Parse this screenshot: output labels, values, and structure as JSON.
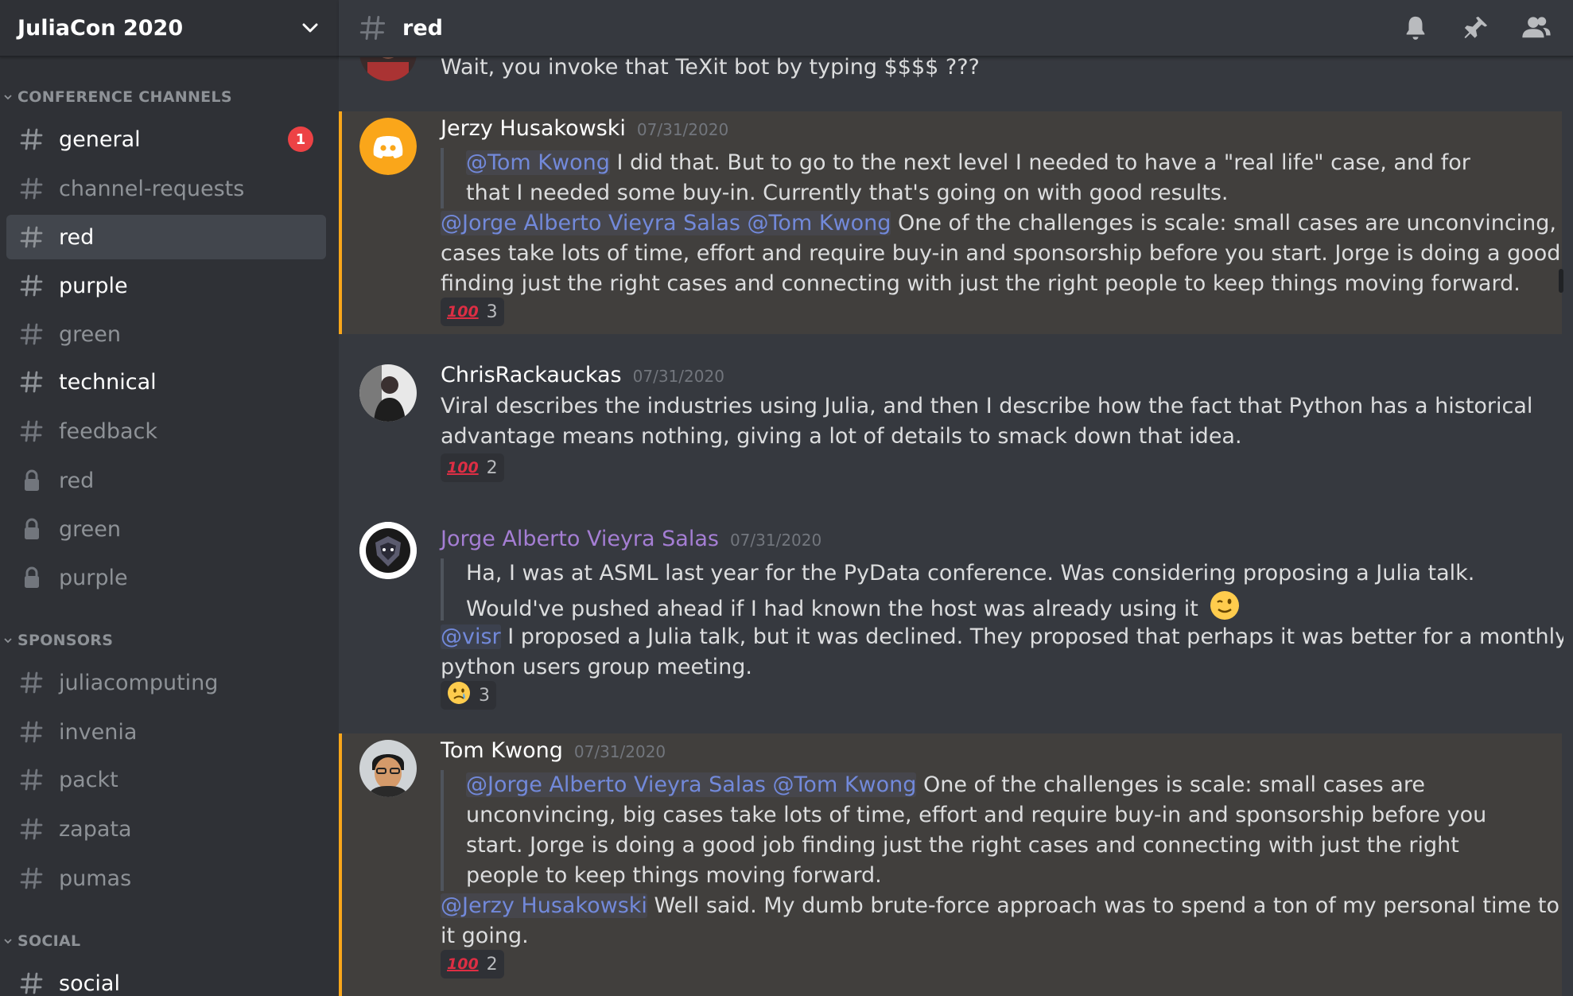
{
  "guild": {
    "name": "JuliaCon 2020"
  },
  "categories": {
    "conference": "CONFERENCE CHANNELS",
    "sponsors": "SPONSORS",
    "social": "SOCIAL"
  },
  "channels": [
    {
      "label": "general",
      "type": "text",
      "state": "unread",
      "badge": "1"
    },
    {
      "label": "channel-requests",
      "type": "text",
      "state": "read"
    },
    {
      "label": "red",
      "type": "text",
      "state": "active"
    },
    {
      "label": "purple",
      "type": "text",
      "state": "unread"
    },
    {
      "label": "green",
      "type": "text",
      "state": "read"
    },
    {
      "label": "technical",
      "type": "text",
      "state": "unread"
    },
    {
      "label": "feedback",
      "type": "text",
      "state": "read"
    },
    {
      "label": "red",
      "type": "locked",
      "state": "read"
    },
    {
      "label": "green",
      "type": "locked",
      "state": "read"
    },
    {
      "label": "purple",
      "type": "locked",
      "state": "read"
    }
  ],
  "sponsor_channels": [
    {
      "label": "juliacomputing",
      "type": "text",
      "state": "read"
    },
    {
      "label": "invenia",
      "type": "text",
      "state": "read"
    },
    {
      "label": "packt",
      "type": "text",
      "state": "read"
    },
    {
      "label": "zapata",
      "type": "text",
      "state": "read"
    },
    {
      "label": "pumas",
      "type": "text",
      "state": "read"
    }
  ],
  "social_channels": [
    {
      "label": "social",
      "type": "text",
      "state": "unread"
    }
  ],
  "topbar": {
    "channel": "red",
    "icons": [
      "bell-icon",
      "pin-icon",
      "members-icon"
    ]
  },
  "messages": [
    {
      "text": "Wait, you invoke that TeXit bot by typing $$$$ ???"
    },
    {
      "author": "Jerzy Husakowski",
      "timestamp": "07/31/2020",
      "quote": [
        {
          "mention": "@Tom Kwong",
          "text": " I did that. But to go to the next level I needed to have a \"real life\" case, and for"
        },
        {
          "text": "that I needed some buy-in. Currently that's going on with good results."
        }
      ],
      "lines": [
        {
          "mention": "@Jorge Alberto Vieyra Salas @Tom Kwong",
          "text": " One of the challenges is scale: small cases are unconvincing, big"
        },
        {
          "text": "cases take lots of time, effort and require buy-in and sponsorship before you start. Jorge is doing a good job"
        },
        {
          "text": "finding just the right cases and connecting with just the right people to keep things moving forward."
        }
      ],
      "reaction": {
        "emoji": "100",
        "count": "3"
      }
    },
    {
      "author": "ChrisRackauckas",
      "timestamp": "07/31/2020",
      "lines": [
        {
          "text": "Viral describes the industries using Julia, and then I describe how the fact that Python has a historical"
        },
        {
          "text": "advantage means nothing, giving a lot of details to smack down that idea."
        }
      ],
      "reaction": {
        "emoji": "100",
        "count": "2"
      }
    },
    {
      "author": "Jorge Alberto Vieyra Salas",
      "timestamp": "07/31/2020",
      "quote": [
        {
          "text": "Ha, I was at ASML last year for the PyData conference. Was considering proposing a Julia talk."
        },
        {
          "text": "Would've pushed ahead if I had known the host was already using it"
        }
      ],
      "lines": [
        {
          "mention": "@visr",
          "text": " I proposed a Julia talk, but it was declined. They proposed that perhaps it was better for a monthly"
        },
        {
          "text": "python users group meeting."
        }
      ],
      "reaction": {
        "emoji": "cry",
        "count": "3"
      }
    },
    {
      "author": "Tom Kwong",
      "timestamp": "07/31/2020",
      "quote": [
        {
          "mention": "@Jorge Alberto Vieyra Salas @Tom Kwong",
          "text": " One of the challenges is scale: small cases are"
        },
        {
          "text": "unconvincing, big cases take lots of time, effort and require buy-in and sponsorship before you"
        },
        {
          "text": "start. Jorge is doing a good job finding just the right cases and connecting with just the right"
        },
        {
          "text": "people to keep things moving forward."
        }
      ],
      "lines": [
        {
          "mention": "@Jerzy Husakowski",
          "text": " Well said.  My dumb brute-force approach was to spend a ton of my personal time to get"
        },
        {
          "text": "it going."
        }
      ],
      "reaction": {
        "emoji": "100",
        "count": "2"
      }
    }
  ],
  "colors": {
    "accent": "#7289da",
    "highlight": "#faa61a",
    "badge": "#ed4245",
    "purple_author": "#a57ed4"
  }
}
